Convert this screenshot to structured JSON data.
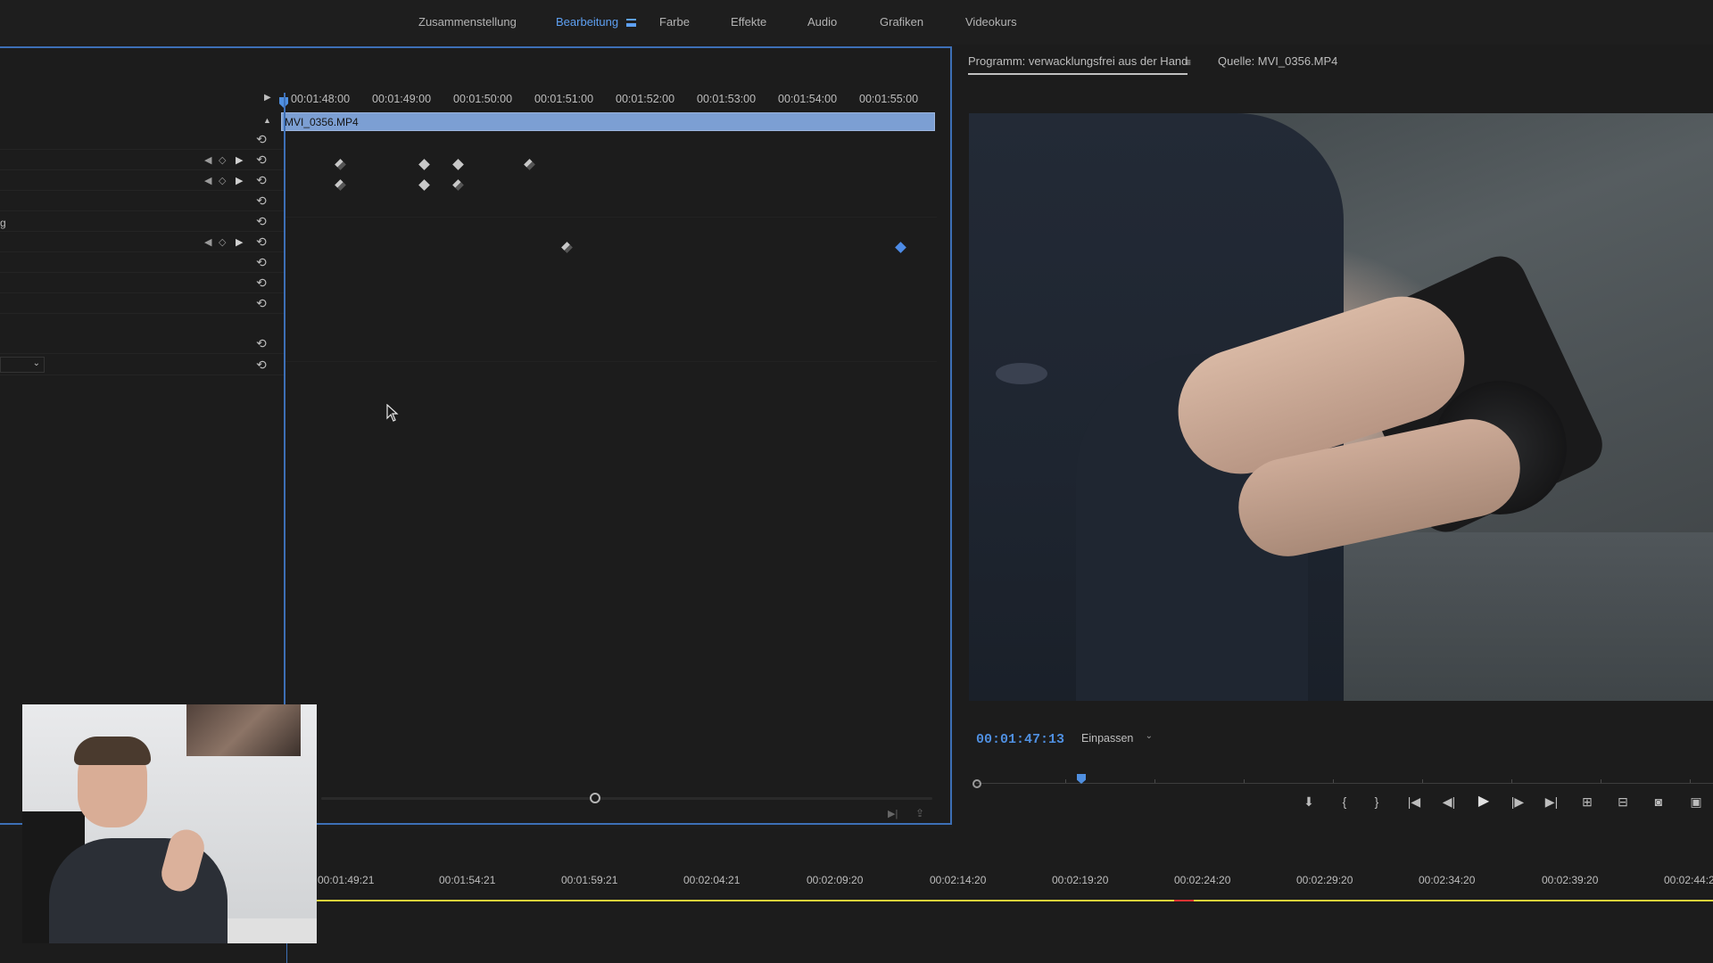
{
  "workspaces": {
    "tabs": [
      "Zusammenstellung",
      "Bearbeitung",
      "Farbe",
      "Effekte",
      "Audio",
      "Grafiken",
      "Videokurs"
    ],
    "active": "Bearbeitung"
  },
  "effect_controls": {
    "ruler_times": [
      "00:01:48:00",
      "00:01:49:00",
      "00:01:50:00",
      "00:01:51:00",
      "00:01:52:00",
      "00:01:53:00",
      "00:01:54:00",
      "00:01:55:00"
    ],
    "clip_name": "MVI_0356.MP4",
    "truncated_label": "g"
  },
  "program_monitor": {
    "program_tab": "Programm: verwacklungsfrei aus der Hand",
    "source_tab": "Quelle: MVI_0356.MP4",
    "timecode": "00:01:47:13",
    "zoom": "Einpassen"
  },
  "timeline": {
    "ruler_times": [
      "00:01:49:21",
      "00:01:54:21",
      "00:01:59:21",
      "00:02:04:21",
      "00:02:09:20",
      "00:02:14:20",
      "00:02:19:20",
      "00:02:24:20",
      "00:02:29:20",
      "00:02:34:20",
      "00:02:39:20",
      "00:02:44:2"
    ]
  },
  "colors": {
    "accent": "#4f8fe0",
    "panel_border": "#3d6fb6",
    "clip_bar": "#7c9fd3",
    "work_area": "#d9d23a"
  },
  "icons": {
    "reset": "reset-icon",
    "transport": [
      "marker-icon",
      "mark-in-icon",
      "mark-out-icon",
      "go-to-in-icon",
      "step-back-icon",
      "play-icon",
      "step-forward-icon",
      "go-to-out-icon",
      "insert-icon",
      "overwrite-icon",
      "export-frame-icon",
      "button-editor-icon"
    ]
  }
}
